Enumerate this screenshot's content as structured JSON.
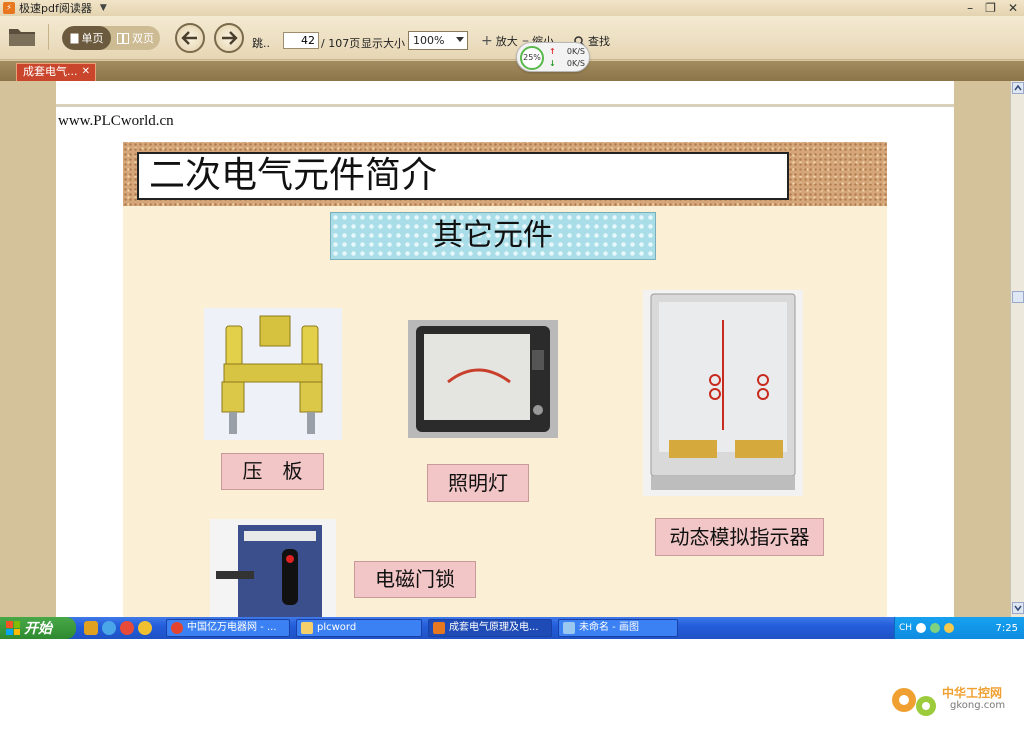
{
  "window": {
    "title": "极速pdf阅读器"
  },
  "toolbar": {
    "single_page_label": "单页",
    "double_page_label": "双页",
    "jump_label": "跳..",
    "current_page": "42",
    "total_pages": "/ 107页",
    "display_size_label": "显示大小",
    "zoom_value": "100%",
    "zoom_in_label": "放大",
    "zoom_out_label": "缩小",
    "search_label": "查找"
  },
  "speed_widget": {
    "percent": "25%",
    "upload": "0K/S",
    "download": "0K/S"
  },
  "tabs": [
    {
      "label": "成套电气..."
    }
  ],
  "document": {
    "url_text": "www.PLCworld.cn",
    "slide_title": "二次电气元件简介",
    "slide_subtitle": "其它元件",
    "labels": {
      "pressure_plate": "压　板",
      "lighting": "照明灯",
      "indicator": "动态模拟指示器",
      "door_lock": "电磁门锁"
    }
  },
  "taskbar": {
    "start_label": "开始",
    "items": [
      {
        "label": "中国亿万电器网 - ..."
      },
      {
        "label": "plcword"
      },
      {
        "label": "成套电气原理及电..."
      },
      {
        "label": "未命名 - 画图"
      }
    ],
    "tray_lang": "CH",
    "clock": "7:25"
  },
  "watermark": {
    "name": "中华工控网",
    "site": "gkong.com"
  },
  "colors": {
    "accent_tab": "#c9462c",
    "taskbar": "#245edb",
    "start": "#3c9a3c"
  }
}
